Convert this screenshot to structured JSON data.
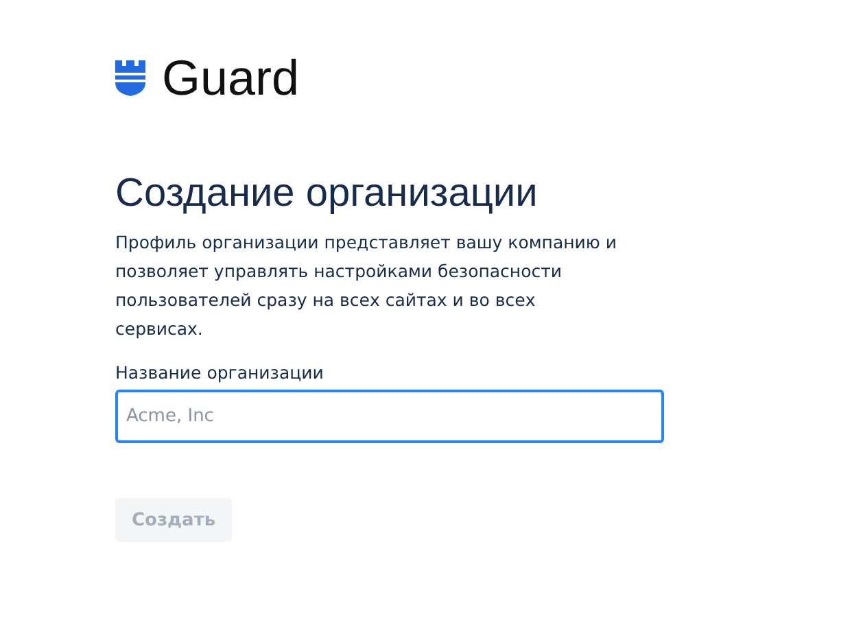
{
  "logo": {
    "text": "Guard"
  },
  "heading": "Создание организации",
  "description": "Профиль организации представляет вашу компанию и позволяет управлять настройками безопасности пользователей сразу на всех сайтах и во всех сервисах.",
  "field": {
    "label": "Название организации",
    "placeholder": "Acme, Inc",
    "focused": true
  },
  "button": {
    "label": "Создать",
    "disabled": true
  }
}
